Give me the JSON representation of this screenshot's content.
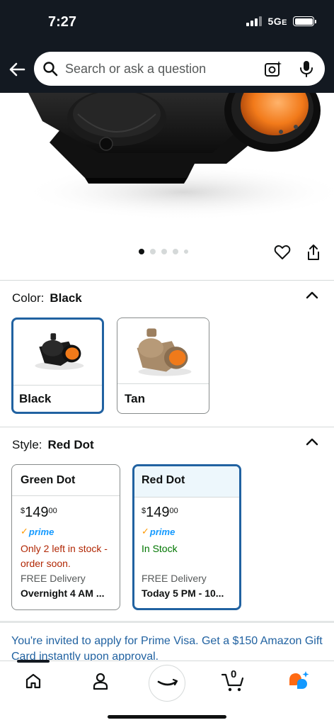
{
  "status_bar": {
    "time": "7:27",
    "network": "5G",
    "network_suffix": "E"
  },
  "search": {
    "placeholder": "Search or ask a question"
  },
  "gallery": {
    "image_count": 5,
    "active_index": 0
  },
  "color_section": {
    "label": "Color:",
    "selected": "Black",
    "options": [
      {
        "label": "Black",
        "selected": true
      },
      {
        "label": "Tan",
        "selected": false
      }
    ]
  },
  "style_section": {
    "label": "Style:",
    "selected": "Red Dot",
    "options": [
      {
        "title": "Green Dot",
        "price_symbol": "$",
        "price_whole": "149",
        "price_fraction": "00",
        "prime": "prime",
        "availability": "Only 2 left in stock - order soon.",
        "delivery_label": "FREE Delivery",
        "delivery_time": "Overnight 4 AM ...",
        "selected": false
      },
      {
        "title": "Red Dot",
        "price_symbol": "$",
        "price_whole": "149",
        "price_fraction": "00",
        "prime": "prime",
        "availability": "In Stock",
        "delivery_label": "FREE Delivery",
        "delivery_time": "Today 5 PM - 10...",
        "selected": true
      }
    ]
  },
  "promo": {
    "text": "You're invited to apply for Prime Visa. Get a $150 Amazon Gift Card instantly upon approval."
  },
  "bottom_nav": {
    "items": [
      "home-icon",
      "account-icon",
      "amazon-logo-icon",
      "cart-icon",
      "rufus-icon"
    ],
    "cart_count": "0"
  },
  "colors": {
    "header_bg": "#131921",
    "link_blue": "#2162a1",
    "selected_border": "#2162a1",
    "low_stock_red": "#b12704",
    "in_stock_green": "#007600",
    "prime_blue": "#1399ff",
    "prime_orange": "#ff9900",
    "rufus_orange": "#ff6a13",
    "rufus_blue": "#1399ff"
  }
}
